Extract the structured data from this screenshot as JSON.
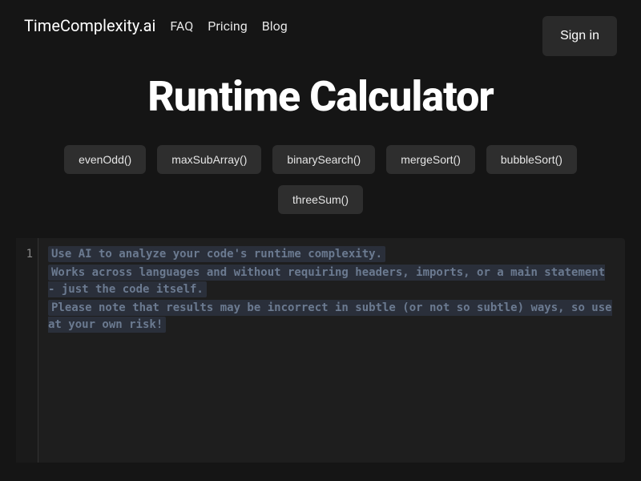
{
  "header": {
    "brand": "TimeComplexity.ai",
    "nav": {
      "faq": "FAQ",
      "pricing": "Pricing",
      "blog": "Blog"
    },
    "signin": "Sign in"
  },
  "hero": {
    "title": "Runtime Calculator"
  },
  "examples": {
    "evenOdd": "evenOdd()",
    "maxSubArray": "maxSubArray()",
    "binarySearch": "binarySearch()",
    "mergeSort": "mergeSort()",
    "bubbleSort": "bubbleSort()",
    "threeSum": "threeSum()"
  },
  "editor": {
    "lineNumber": "1",
    "placeholder": {
      "line1": "Use AI to analyze your code's runtime complexity.",
      "line2": "Works across languages and without requiring headers, imports, or a main statement - just the code itself.",
      "line3": "Please note that results may be incorrect in subtle (or not so subtle) ways, so use at your own risk!"
    }
  }
}
